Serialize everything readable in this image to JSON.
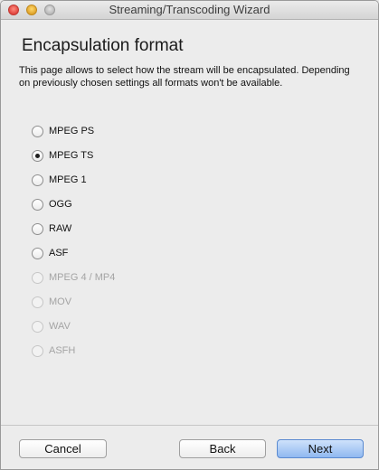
{
  "window": {
    "title": "Streaming/Transcoding Wizard"
  },
  "page": {
    "heading": "Encapsulation format",
    "description": "This page allows to select how the stream will be encapsulated. Depending on previously chosen settings all formats won't be available."
  },
  "formats": [
    {
      "label": "MPEG PS",
      "checked": false,
      "enabled": true
    },
    {
      "label": "MPEG TS",
      "checked": true,
      "enabled": true
    },
    {
      "label": "MPEG 1",
      "checked": false,
      "enabled": true
    },
    {
      "label": "OGG",
      "checked": false,
      "enabled": true
    },
    {
      "label": "RAW",
      "checked": false,
      "enabled": true
    },
    {
      "label": "ASF",
      "checked": false,
      "enabled": true
    },
    {
      "label": "MPEG 4 / MP4",
      "checked": false,
      "enabled": false
    },
    {
      "label": "MOV",
      "checked": false,
      "enabled": false
    },
    {
      "label": "WAV",
      "checked": false,
      "enabled": false
    },
    {
      "label": "ASFH",
      "checked": false,
      "enabled": false
    }
  ],
  "buttons": {
    "cancel": "Cancel",
    "back": "Back",
    "next": "Next"
  },
  "colors": {
    "default_button": "#8fb8f0",
    "disabled_text": "#a4a4a4"
  }
}
